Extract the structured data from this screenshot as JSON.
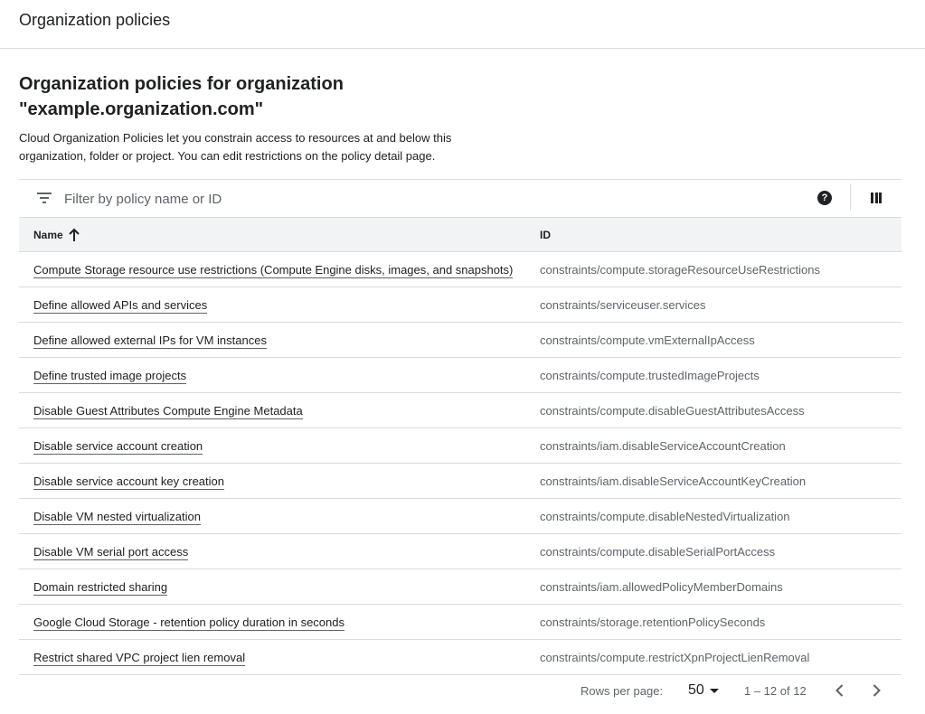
{
  "topbar": {
    "title": "Organization policies"
  },
  "heading": "Organization policies for organization \"example.organization.com\"",
  "description": "Cloud Organization Policies let you constrain access to resources at and below this organization, folder or project. You can edit restrictions on the policy detail page.",
  "filter": {
    "placeholder": "Filter by policy name or ID",
    "value": ""
  },
  "toolbar": {
    "help_icon": "help-icon",
    "columns_icon": "column-display-icon"
  },
  "table": {
    "headers": {
      "name": "Name",
      "id": "ID"
    },
    "sort": {
      "column": "Name",
      "direction": "ascending"
    },
    "rows": [
      {
        "name": "Compute Storage resource use restrictions (Compute Engine disks, images, and snapshots)",
        "id": "constraints/compute.storageResourceUseRestrictions"
      },
      {
        "name": "Define allowed APIs and services",
        "id": "constraints/serviceuser.services"
      },
      {
        "name": "Define allowed external IPs for VM instances",
        "id": "constraints/compute.vmExternalIpAccess"
      },
      {
        "name": "Define trusted image projects",
        "id": "constraints/compute.trustedImageProjects"
      },
      {
        "name": "Disable Guest Attributes Compute Engine Metadata",
        "id": "constraints/compute.disableGuestAttributesAccess"
      },
      {
        "name": "Disable service account creation",
        "id": "constraints/iam.disableServiceAccountCreation"
      },
      {
        "name": "Disable service account key creation",
        "id": "constraints/iam.disableServiceAccountKeyCreation"
      },
      {
        "name": "Disable VM nested virtualization",
        "id": "constraints/compute.disableNestedVirtualization"
      },
      {
        "name": "Disable VM serial port access",
        "id": "constraints/compute.disableSerialPortAccess"
      },
      {
        "name": "Domain restricted sharing",
        "id": "constraints/iam.allowedPolicyMemberDomains"
      },
      {
        "name": "Google Cloud Storage - retention policy duration in seconds",
        "id": "constraints/storage.retentionPolicySeconds"
      },
      {
        "name": "Restrict shared VPC project lien removal",
        "id": "constraints/compute.restrictXpnProjectLienRemoval"
      }
    ]
  },
  "pagination": {
    "rows_label": "Rows per page:",
    "rows_per_page": "50",
    "range": "1 – 12 of 12"
  }
}
